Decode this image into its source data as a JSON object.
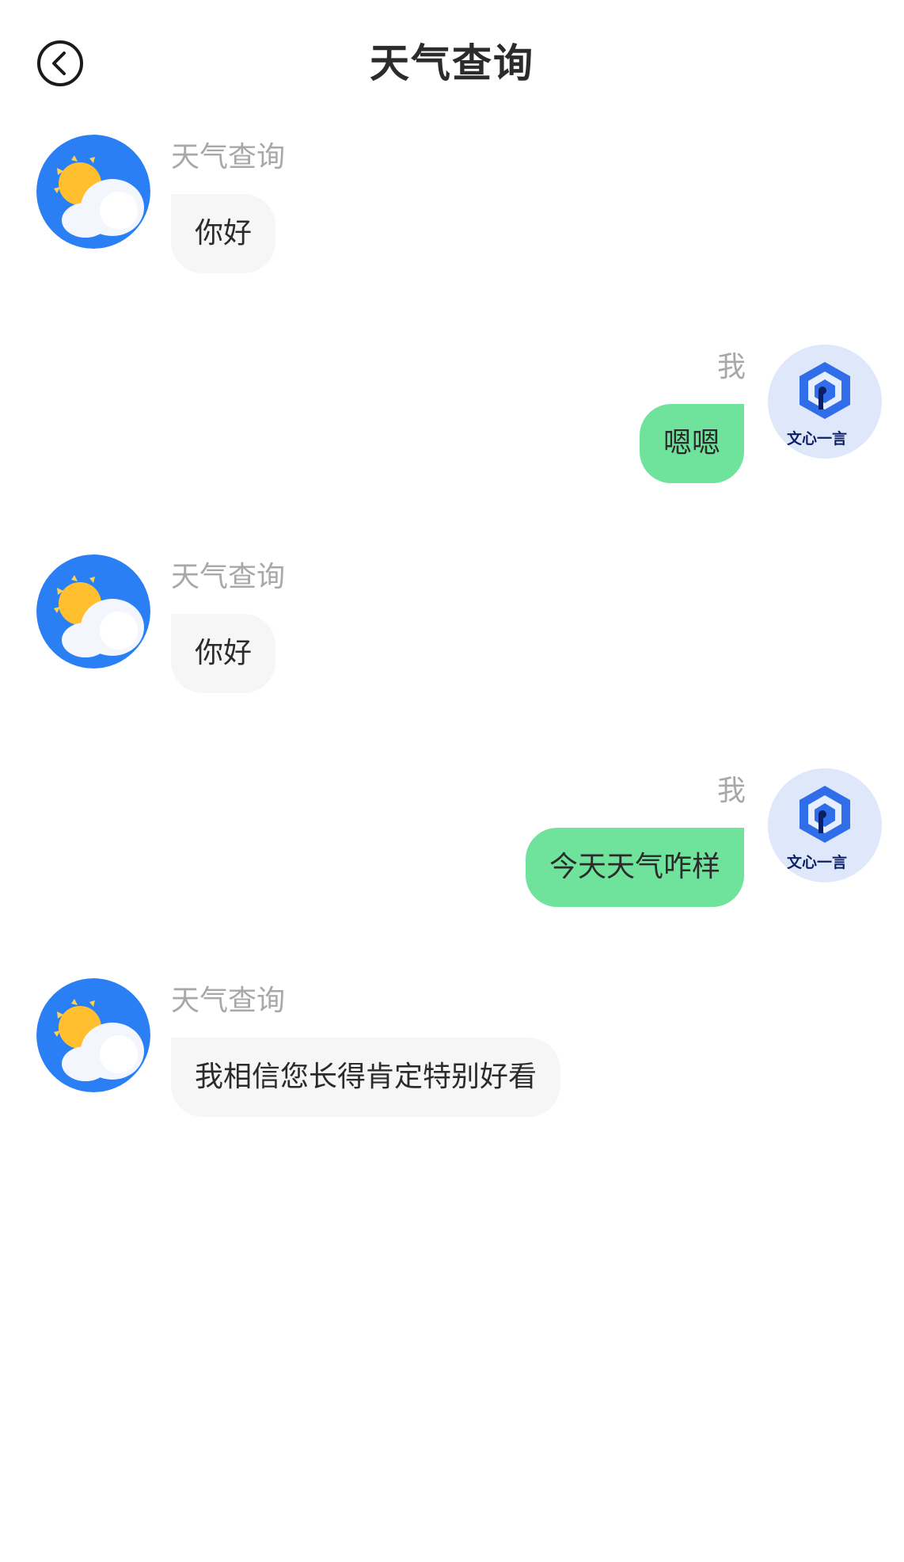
{
  "header": {
    "title": "天气查询",
    "back_icon": "back-arrow-icon"
  },
  "colors": {
    "bot_bubble": "#f6f6f6",
    "user_bubble": "#6fe29b",
    "sender_name": "#a8a8a8",
    "text": "#2b2b2b",
    "bot_avatar_blue": "#2b7ff5",
    "user_avatar_bg": "#dfe8fb"
  },
  "bot": {
    "name": "天气查询",
    "avatar_icon": "weather-sun-cloud-icon"
  },
  "user": {
    "name": "我",
    "avatar_icon": "wenxin-yiyan-logo-icon",
    "avatar_logo_text": "文心一言"
  },
  "messages": [
    {
      "sender": "bot",
      "text": "你好"
    },
    {
      "sender": "user",
      "text": "嗯嗯"
    },
    {
      "sender": "bot",
      "text": "你好"
    },
    {
      "sender": "user",
      "text": "今天天气咋样"
    },
    {
      "sender": "bot",
      "text": "我相信您长得肯定特别好看"
    }
  ]
}
